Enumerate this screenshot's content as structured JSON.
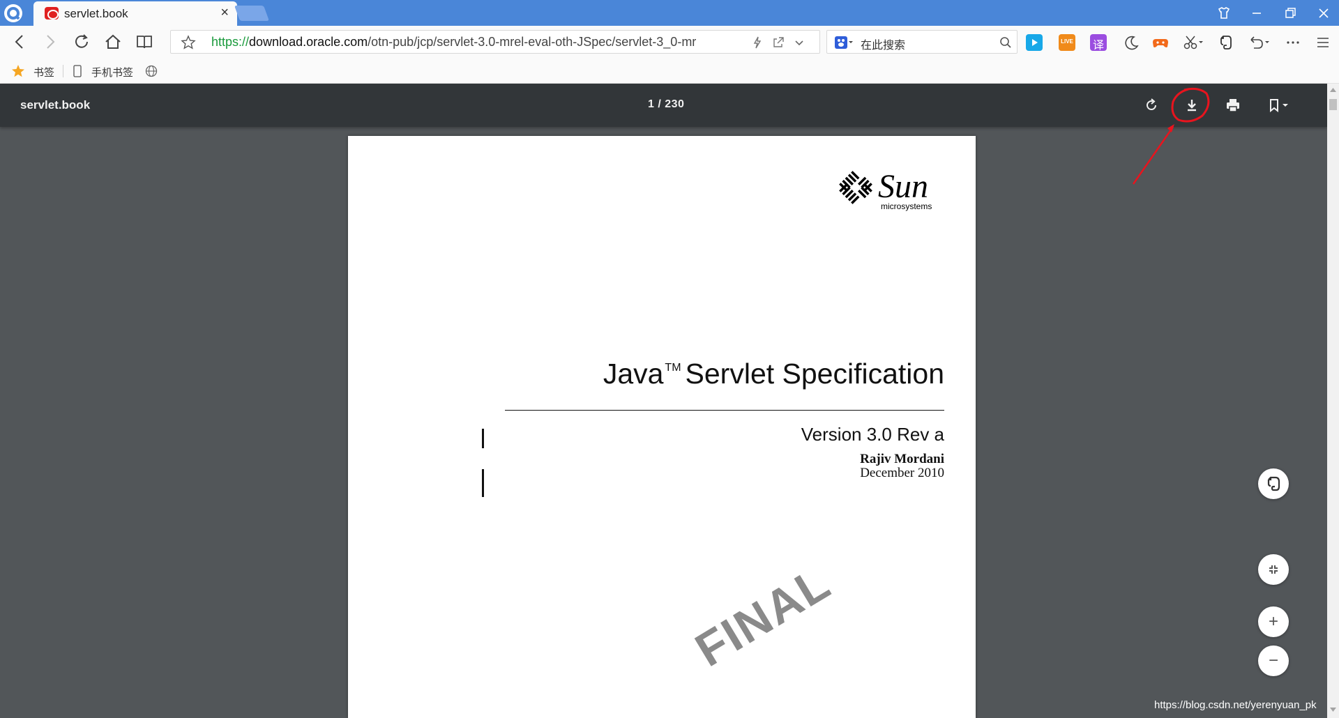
{
  "browser": {
    "tab_title": "servlet.book",
    "tab_close": "×",
    "url_scheme": "https://",
    "url_host": "download.oracle.com",
    "url_path": "/otn-pub/jcp/servlet-3.0-mrel-eval-oth-JSpec/servlet-3_0-mr",
    "search_placeholder": "在此搜索",
    "ext_live_label": "LIVE",
    "ext_translate_label": "译"
  },
  "bookmarks": {
    "items": [
      "书签",
      "手机书签"
    ]
  },
  "viewer": {
    "title": "servlet.book",
    "page_indicator": "1 / 230"
  },
  "document": {
    "logo_text": "Sun",
    "logo_subtext": "microsystems",
    "title_main": "Java",
    "title_tm": "TM",
    "title_rest": "Servlet Specification",
    "version": "Version 3.0 Rev a",
    "author": "Rajiv Mordani",
    "date": "December 2010",
    "watermark": "FINAL"
  },
  "floating": {
    "zoom_in": "+",
    "zoom_out": "−"
  },
  "overlay": {
    "source_url": "https://blog.csdn.net/yerenyuan_pk"
  },
  "colors": {
    "tabbar": "#4a86d8",
    "toolbar": "#323639",
    "viewer_bg": "#525659",
    "annotation": "#e8141e",
    "url_scheme": "#1a9a3c"
  }
}
